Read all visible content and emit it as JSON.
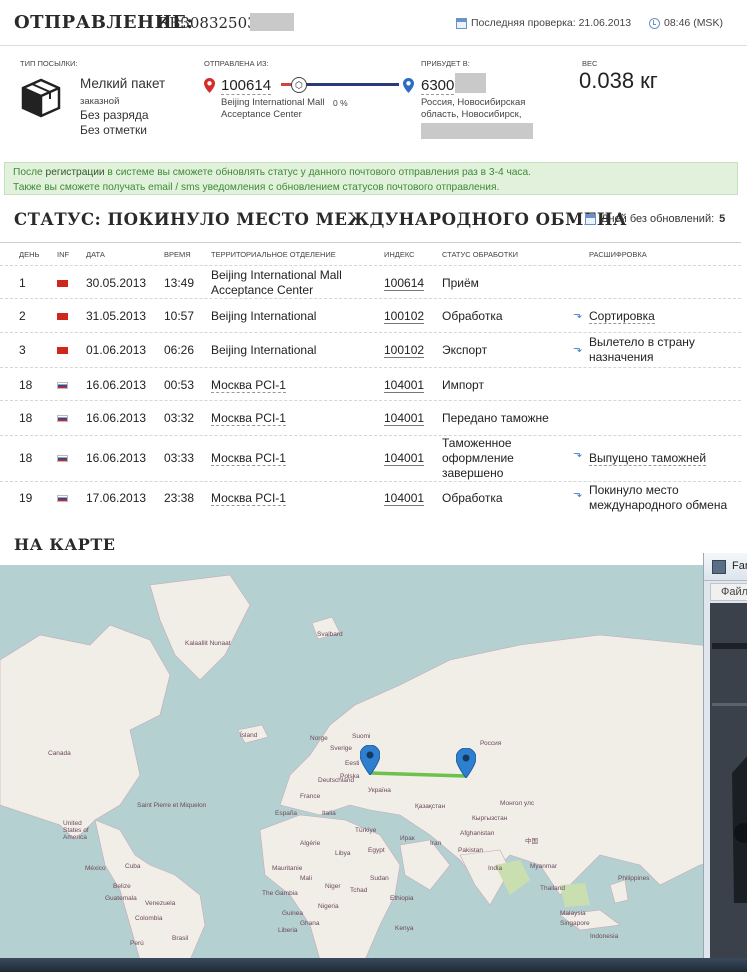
{
  "header": {
    "title": "ОТПРАВЛЕНИЕ:",
    "tracking_number": "RB30832503",
    "last_check": "Последняя проверка: 21.06.2013",
    "time": "08:46 (MSK)"
  },
  "info": {
    "type_label": "ТИП ПОСЫЛКИ:",
    "type_name": "Мелкий пакет",
    "type_sub": "заказной",
    "type_cat": "Без разряда",
    "type_mark": "Без отметки",
    "from_label": "ОТПРАВЛЕНА ИЗ:",
    "from_index": "100614",
    "from_address": "Beijing International Mall Acceptance Center",
    "progress_pct": "0 %",
    "to_label": "ПРИБУДЕТ В:",
    "to_index": "6300",
    "to_address": "Россия, Новосибирская область, Новосибирск,",
    "weight_label": "ВЕС",
    "weight": "0.038 кг"
  },
  "notice": {
    "line1_pre": "После ",
    "line1_link": "регистрации",
    "line1_post": " в системе вы сможете обновлять статус у данного почтового отправления раз в 3-4 часа.",
    "line2": "Также вы сможете получать email / sms уведомления с обновлением статусов почтового отправления."
  },
  "status": {
    "title": "СТАТУС: ПОКИНУЛО МЕСТО МЕЖДУНАРОДНОГО ОБМЕНА",
    "days_label": "Дней без обновлений:",
    "days_value": "5"
  },
  "table": {
    "headers": [
      "ДЕНЬ",
      "INF",
      "ДАТА",
      "ВРЕМЯ",
      "ТЕРРИТОРИАЛЬНОЕ ОТДЕЛЕНИЕ",
      "ИНДЕКС",
      "СТАТУС ОБРАБОТКИ",
      "РАСШИФРОВКА"
    ],
    "rows": [
      {
        "day": "1",
        "flag": "cn",
        "date": "30.05.2013",
        "time": "13:49",
        "office": "Beijing International Mall Acceptance Center",
        "index": "100614",
        "status": "Приём",
        "decode": ""
      },
      {
        "day": "2",
        "flag": "cn",
        "date": "31.05.2013",
        "time": "10:57",
        "office": "Beijing International",
        "index": "100102",
        "status": "Обработка",
        "decode": "Сортировка"
      },
      {
        "day": "3",
        "flag": "cn",
        "date": "01.06.2013",
        "time": "06:26",
        "office": "Beijing International",
        "index": "100102",
        "status": "Экспорт",
        "decode": "Вылетело в страну назначения"
      },
      {
        "day": "18",
        "flag": "ru",
        "date": "16.06.2013",
        "time": "00:53",
        "office": "Москва PCI-1",
        "index": "104001",
        "status": "Импорт",
        "decode": ""
      },
      {
        "day": "18",
        "flag": "ru",
        "date": "16.06.2013",
        "time": "03:32",
        "office": "Москва PCI-1",
        "index": "104001",
        "status": "Передано таможне",
        "decode": ""
      },
      {
        "day": "18",
        "flag": "ru",
        "date": "16.06.2013",
        "time": "03:33",
        "office": "Москва PCI-1",
        "index": "104001",
        "status": "Таможенное оформление завершено",
        "decode": "Выпущено таможней"
      },
      {
        "day": "19",
        "flag": "ru",
        "date": "17.06.2013",
        "time": "23:38",
        "office": "Москва PCI-1",
        "index": "104001",
        "status": "Обработка",
        "decode": "Покинуло место международного обмена"
      }
    ]
  },
  "map": {
    "title": "НА КАРТЕ",
    "labels": [
      "Kalaallit Nunaat",
      "Svalbard",
      "Ísland",
      "Canada",
      "Saint Pierre et Miquelon",
      "United States of America",
      "México",
      "Cuba",
      "Belize",
      "Guatemala",
      "Venezuela",
      "Colombia",
      "Brasil",
      "Perú",
      "Norge",
      "Sverige",
      "Suomi",
      "Eesti",
      "Россия",
      "Қазақстан",
      "Монгол улс",
      "中国",
      "Türkiye",
      "Mauritanie",
      "Mali",
      "Niger",
      "Tchad",
      "Sudan",
      "Ethiopia",
      "Nigeria",
      "España",
      "France",
      "Deutschland",
      "Polska",
      "Україна",
      "Italia",
      "Algérie",
      "Libya",
      "Egypt",
      "Iran",
      "Afghanistan",
      "Pakistan",
      "India",
      "Myanmar",
      "Thailand",
      "Indonesia",
      "Philippines",
      "Malaysia",
      "Singapore",
      "Кыргызстан",
      "Ирак",
      "The Gambia",
      "Guinea",
      "Ghana",
      "Liberia",
      "Kenya"
    ]
  },
  "overlay": {
    "title": "Far",
    "menu": "Файл"
  },
  "colors": {
    "accent_blue": "#2b6cc4",
    "route_green": "#6cc24a",
    "notice_bg": "#e1f1dc",
    "notice_text": "#3d8a36"
  }
}
